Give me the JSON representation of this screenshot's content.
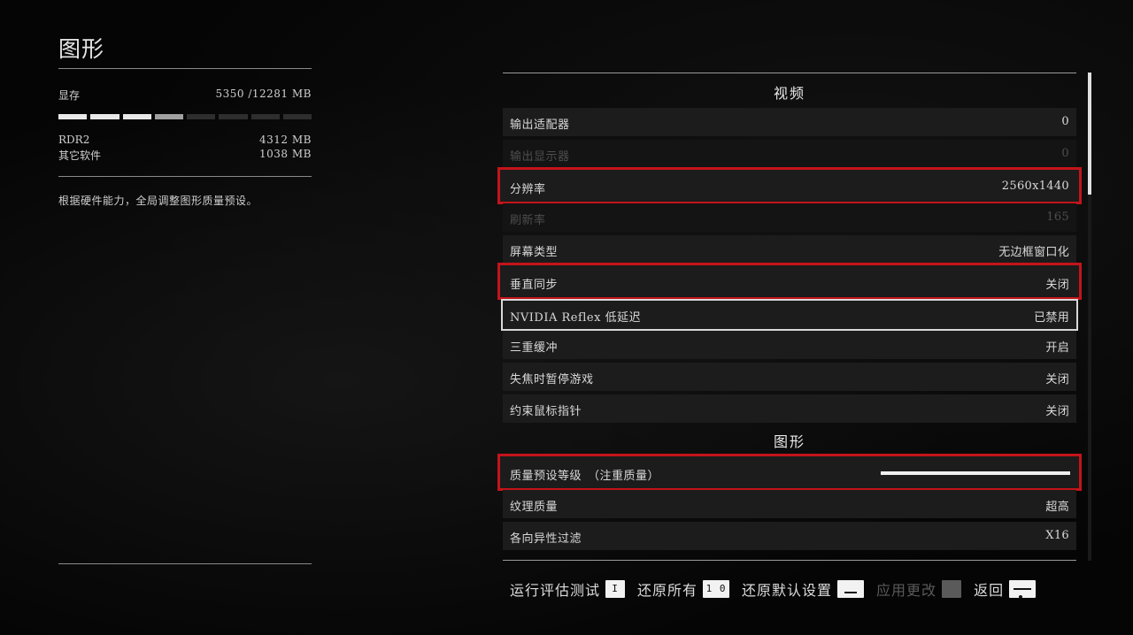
{
  "left_panel": {
    "title": "图形",
    "vram": {
      "label": "显存",
      "value": "5350 /12281 MB",
      "usage_fraction": 0.436
    },
    "rdr2": {
      "label": "RDR2",
      "value": "4312 MB"
    },
    "other": {
      "label": "其它软件",
      "value": "1038 MB"
    },
    "description": "根据硬件能力，全局调整图形质量预设。"
  },
  "right_panel": {
    "video_header": "视频",
    "graphics_header": "图形",
    "rows": {
      "output_adapter": {
        "label": "输出适配器",
        "value": "0"
      },
      "output_monitor": {
        "label": "输出显示器",
        "value": "0"
      },
      "resolution": {
        "label": "分辨率",
        "value": "2560x1440"
      },
      "refresh_rate": {
        "label": "刷新率",
        "value": "165"
      },
      "screen_type": {
        "label": "屏幕类型",
        "value": "无边框窗口化"
      },
      "vsync": {
        "label": "垂直同步",
        "value": "关闭"
      },
      "reflex": {
        "label": "NVIDIA Reflex 低延迟",
        "value": "已禁用"
      },
      "triple_buffer": {
        "label": "三重缓冲",
        "value": "开启"
      },
      "pause_on_focus_loss": {
        "label": "失焦时暂停游戏",
        "value": "关闭"
      },
      "confine_cursor": {
        "label": "约束鼠标指针",
        "value": "关闭"
      },
      "quality_preset": {
        "label": "质量预设等级　（注重质量）",
        "level_fraction": 1.0
      },
      "texture_quality": {
        "label": "纹理质量",
        "value": "超高"
      },
      "anisotropic": {
        "label": "各向异性过滤",
        "value": "X16"
      }
    }
  },
  "footer": {
    "run_benchmark": {
      "label": "运行评估测试",
      "key": "I"
    },
    "reset_all": {
      "label": "还原所有",
      "key": "1 0"
    },
    "restore_defaults": {
      "label": "还原默认设置"
    },
    "apply_changes": {
      "label": "应用更改"
    },
    "back": {
      "label": "返回"
    }
  },
  "colors": {
    "highlight_red": "#c4141a",
    "highlight_white": "#d8d8d8"
  }
}
